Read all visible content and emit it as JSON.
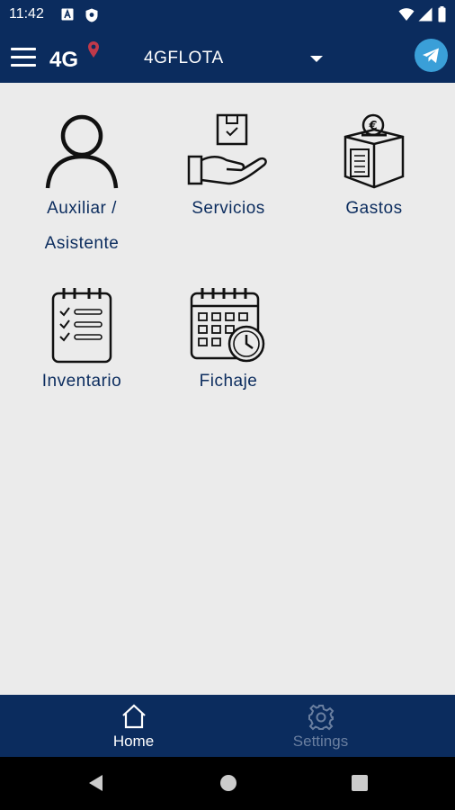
{
  "status_bar": {
    "time": "11:42"
  },
  "app_bar": {
    "logo_text": "4G",
    "fleet_name": "4GFLOTA",
    "accent_color": "#0b2c5e",
    "telegram_color": "#3a9fd8"
  },
  "tiles": [
    {
      "label": "Auxiliar / Asistente",
      "icon": "person-icon"
    },
    {
      "label": "Servicios",
      "icon": "hand-box-icon"
    },
    {
      "label": "Gastos",
      "icon": "money-box-icon"
    },
    {
      "label": "Inventario",
      "icon": "checklist-icon"
    },
    {
      "label": "Fichaje",
      "icon": "calendar-clock-icon"
    }
  ],
  "bottom_nav": {
    "home_label": "Home",
    "settings_label": "Settings"
  }
}
